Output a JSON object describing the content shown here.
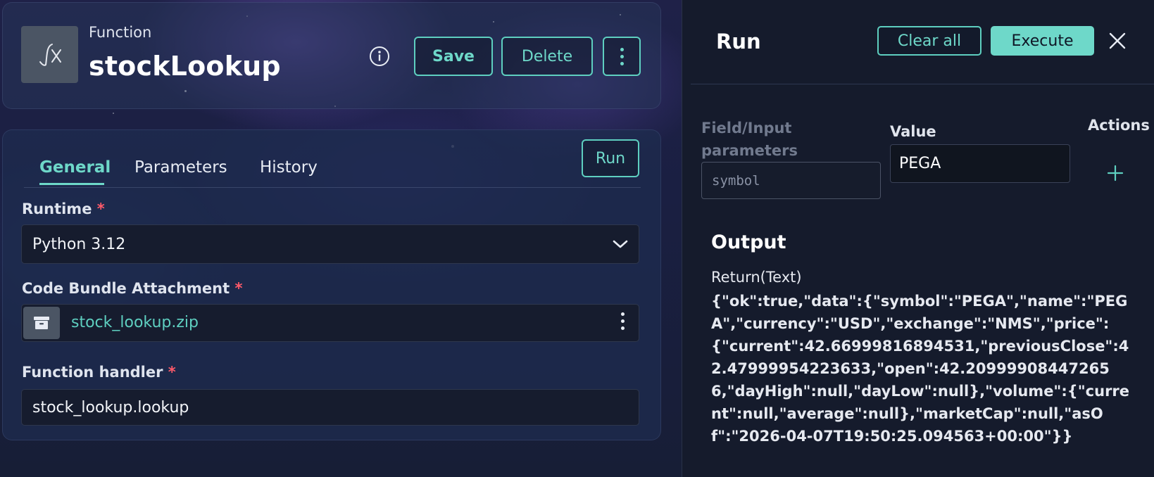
{
  "function": {
    "kind_label": "Function",
    "name": "stockLookup",
    "save_label": "Save",
    "delete_label": "Delete"
  },
  "tabs": [
    {
      "label": "General",
      "active": true
    },
    {
      "label": "Parameters",
      "active": false
    },
    {
      "label": "History",
      "active": false
    }
  ],
  "run_button_label": "Run",
  "form": {
    "runtime_label": "Runtime",
    "runtime_value": "Python 3.12",
    "bundle_label": "Code Bundle Attachment",
    "bundle_file": "stock_lookup.zip",
    "handler_label": "Function handler",
    "handler_value": "stock_lookup.lookup",
    "required_mark": "*"
  },
  "run_panel": {
    "title": "Run",
    "clear_all_label": "Clear all",
    "execute_label": "Execute",
    "columns": {
      "field": "Field/Input parameters",
      "value": "Value",
      "actions": "Actions"
    },
    "param_name": "symbol",
    "param_value": "PEGA",
    "output_title": "Output",
    "output_type": "Return(Text)",
    "output_text": "{\"ok\":true,\"data\":{\"symbol\":\"PEGA\",\"name\":\"PEGA\",\"currency\":\"USD\",\"exchange\":\"NMS\",\"price\":{\"current\":42.66999816894531,\"previousClose\":42.47999954223633,\"open\":42.209999084472656,\"dayHigh\":null,\"dayLow\":null},\"volume\":{\"current\":null,\"average\":null},\"marketCap\":null,\"asOf\":\"2026-04-07T19:50:25.094563+00:00\"}}"
  },
  "colors": {
    "accent": "#6ed8c9",
    "required": "#ff5a6a",
    "panel_bg": "#151b2c"
  }
}
